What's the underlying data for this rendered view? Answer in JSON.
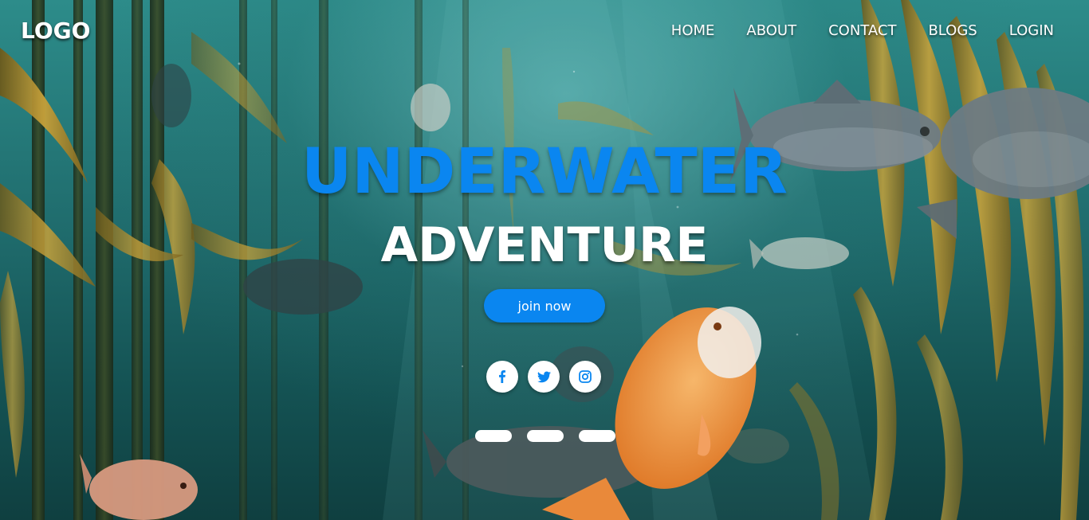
{
  "brand": {
    "logo": "LOGO"
  },
  "nav": {
    "items": [
      {
        "label": "HOME"
      },
      {
        "label": "ABOUT"
      },
      {
        "label": "CONTACT"
      },
      {
        "label": "BLOGS"
      },
      {
        "label": "LOGIN"
      }
    ]
  },
  "hero": {
    "title": "UNDERWATER",
    "subtitle": "ADVENTURE",
    "cta_label": "join now"
  },
  "socials": [
    {
      "icon": "facebook-icon"
    },
    {
      "icon": "twitter-icon"
    },
    {
      "icon": "instagram-icon"
    }
  ],
  "slider": {
    "dot_count": 3
  },
  "colors": {
    "accent": "#0a86f0",
    "text": "#ffffff",
    "water_top": "#2d8c8a",
    "water_bottom": "#0f3f40",
    "kelp": "#b59433"
  }
}
